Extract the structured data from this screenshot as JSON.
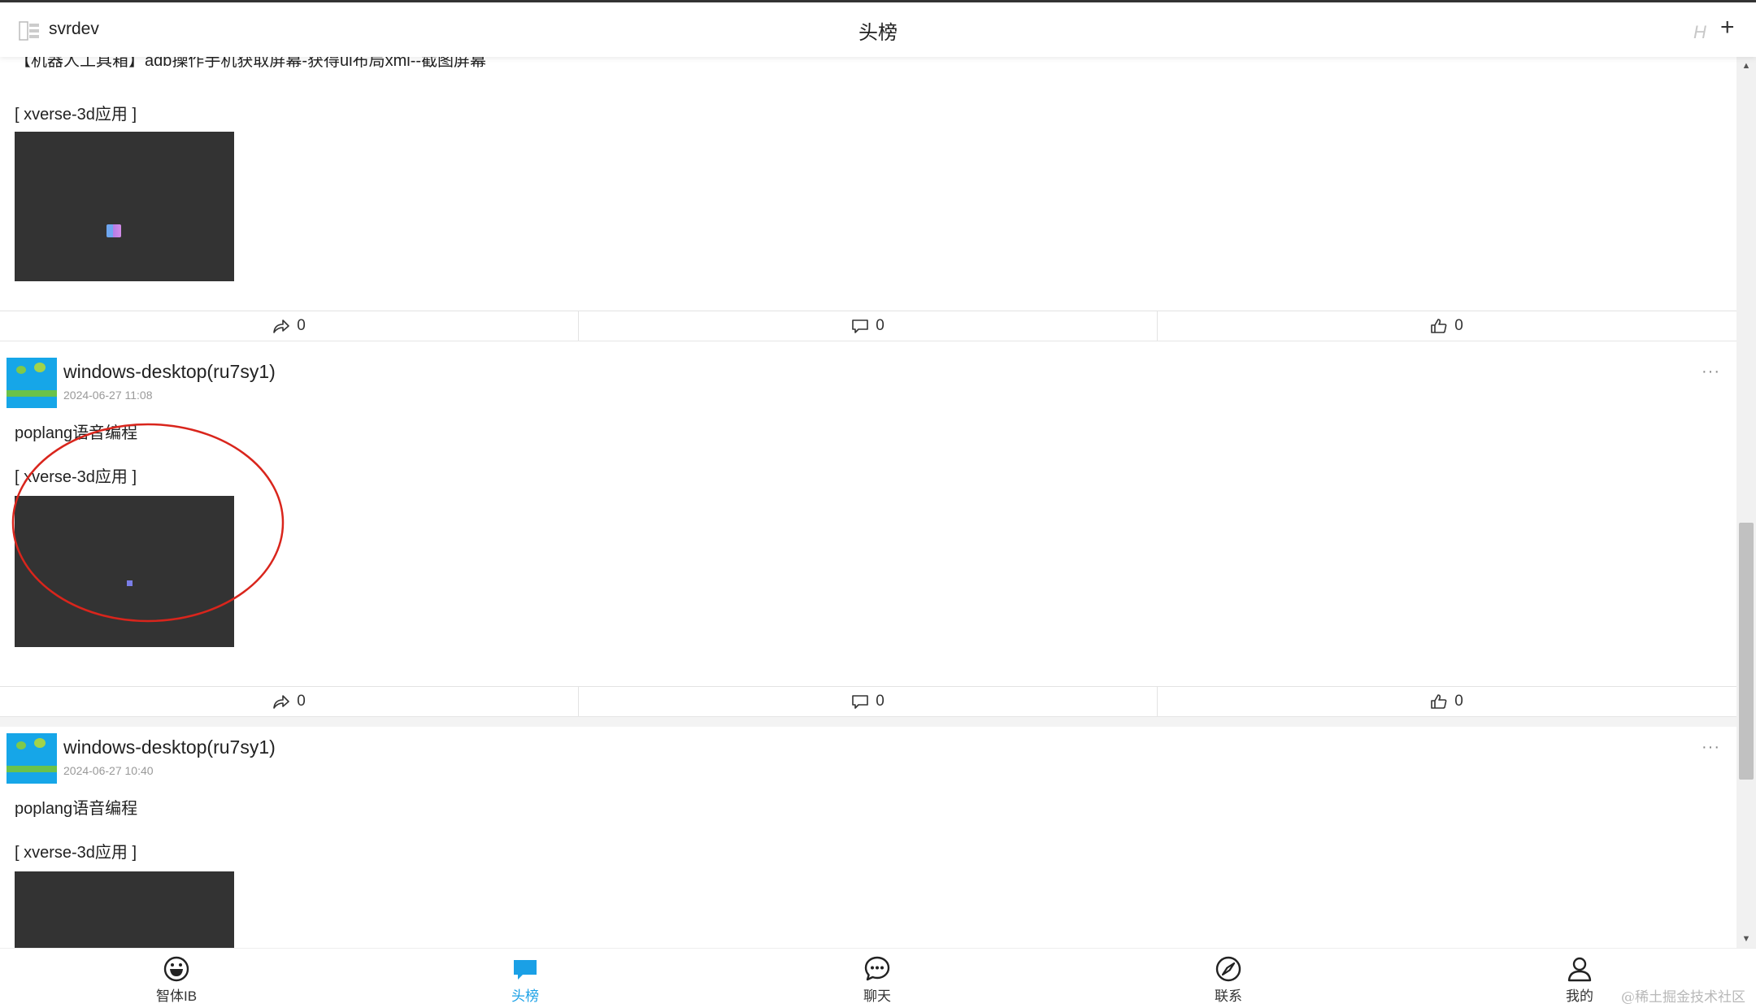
{
  "header": {
    "account_name": "svrdev",
    "title": "头榜",
    "h_label": "H",
    "plus_label": "+"
  },
  "posts": [
    {
      "text_partial": "【机器人工具箱】adb操作手机获取屏幕-获得ui布局xml--截图屏幕",
      "app_tag": "[ xverse-3d应用 ]",
      "shares": "0",
      "comments": "0",
      "likes": "0"
    },
    {
      "username": "windows-desktop(ru7sy1)",
      "time": "2024-06-27 11:08",
      "text": "poplang语音编程",
      "app_tag": "[ xverse-3d应用 ]",
      "shares": "0",
      "comments": "0",
      "likes": "0"
    },
    {
      "username": "windows-desktop(ru7sy1)",
      "time": "2024-06-27 10:40",
      "text": "poplang语音编程",
      "app_tag": "[ xverse-3d应用 ]"
    }
  ],
  "more_label": "···",
  "nav": {
    "items": [
      {
        "label": "智体IB",
        "icon": "smiley-icon"
      },
      {
        "label": "头榜",
        "icon": "chat-bubble-icon",
        "active": true
      },
      {
        "label": "聊天",
        "icon": "chat-icon"
      },
      {
        "label": "联系",
        "icon": "compass-icon"
      },
      {
        "label": "我的",
        "icon": "user-icon"
      }
    ]
  },
  "watermark": "@稀土掘金技术社区",
  "colors": {
    "accent": "#1aa0e6",
    "thumb_bg": "#333333",
    "annotation": "#d9251c"
  }
}
